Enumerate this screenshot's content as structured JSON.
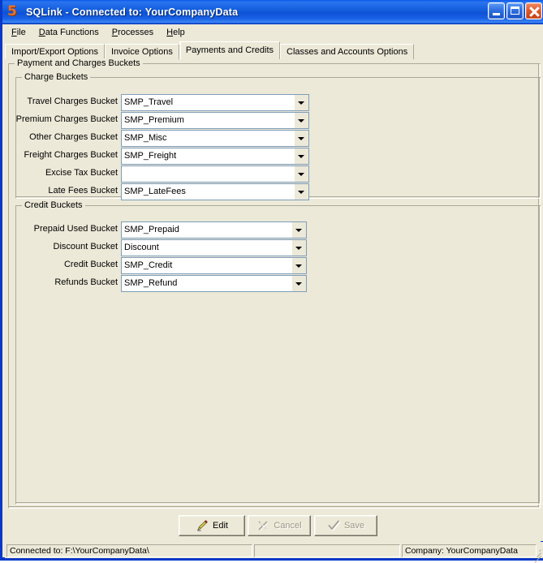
{
  "window": {
    "title": "SQLink - Connected to: YourCompanyData",
    "icon": "app-5-icon",
    "icon_glyph": "5",
    "caption_buttons": [
      {
        "name": "minimize-button",
        "label": "Minimize"
      },
      {
        "name": "maximize-button",
        "label": "Maximize"
      },
      {
        "name": "close-button",
        "label": "Close"
      }
    ],
    "titlebar_color": "#0a48c0",
    "face_color": "#ece9d8"
  },
  "menubar": {
    "items": [
      {
        "label": "File",
        "accel": "F"
      },
      {
        "label": "Data Functions",
        "accel": "D"
      },
      {
        "label": "Processes",
        "accel": "P"
      },
      {
        "label": "Help",
        "accel": "H"
      }
    ]
  },
  "tabs": {
    "selected": "Payments and Credits",
    "items": [
      {
        "label": "Import/Export Options",
        "active": false
      },
      {
        "label": "Invoice Options",
        "active": false
      },
      {
        "label": "Payments and Credits",
        "active": true
      },
      {
        "label": "Classes and Accounts Options",
        "active": false
      }
    ]
  },
  "main": {
    "outer_group_title": "Payment and Charges Buckets",
    "charge_group": {
      "title": "Charge Buckets",
      "fields": [
        {
          "label": "Travel Charges Bucket",
          "value": "SMP_Travel"
        },
        {
          "label": "Premium Charges Bucket",
          "value": "SMP_Premium"
        },
        {
          "label": "Other Charges Bucket",
          "value": "SMP_Misc"
        },
        {
          "label": "Freight Charges Bucket",
          "value": "SMP_Freight"
        },
        {
          "label": "Excise Tax Bucket",
          "value": ""
        },
        {
          "label": "Late Fees Bucket",
          "value": "SMP_LateFees"
        }
      ]
    },
    "credit_group": {
      "title": "Credit Buckets",
      "fields": [
        {
          "label": "Prepaid Used Bucket",
          "value": "SMP_Prepaid"
        },
        {
          "label": "Discount Bucket",
          "value": "Discount"
        },
        {
          "label": "Credit Bucket",
          "value": "SMP_Credit"
        },
        {
          "label": "Refunds Bucket",
          "value": "SMP_Refund"
        }
      ]
    }
  },
  "buttons": {
    "edit": {
      "label": "Edit",
      "icon": "pencil-icon",
      "enabled": true
    },
    "cancel": {
      "label": "Cancel",
      "icon": "x-mark-icon",
      "enabled": false
    },
    "save": {
      "label": "Save",
      "icon": "checkmark-icon",
      "enabled": false
    }
  },
  "statusbar": {
    "pane1": "Connected to: F:\\YourCompanyData\\",
    "pane2": "",
    "pane3": "Company: YourCompanyData"
  }
}
